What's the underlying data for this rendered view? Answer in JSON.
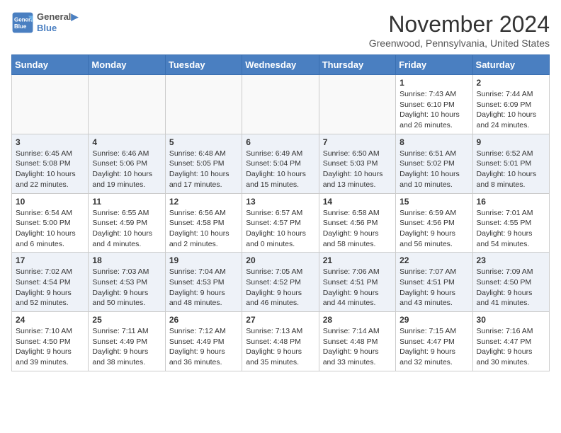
{
  "logo": {
    "line1": "General",
    "line2": "Blue"
  },
  "title": "November 2024",
  "location": "Greenwood, Pennsylvania, United States",
  "days_header": [
    "Sunday",
    "Monday",
    "Tuesday",
    "Wednesday",
    "Thursday",
    "Friday",
    "Saturday"
  ],
  "weeks": [
    [
      {
        "day": "",
        "sunrise": "",
        "sunset": "",
        "daylight": ""
      },
      {
        "day": "",
        "sunrise": "",
        "sunset": "",
        "daylight": ""
      },
      {
        "day": "",
        "sunrise": "",
        "sunset": "",
        "daylight": ""
      },
      {
        "day": "",
        "sunrise": "",
        "sunset": "",
        "daylight": ""
      },
      {
        "day": "",
        "sunrise": "",
        "sunset": "",
        "daylight": ""
      },
      {
        "day": "1",
        "sunrise": "Sunrise: 7:43 AM",
        "sunset": "Sunset: 6:10 PM",
        "daylight": "Daylight: 10 hours and 26 minutes."
      },
      {
        "day": "2",
        "sunrise": "Sunrise: 7:44 AM",
        "sunset": "Sunset: 6:09 PM",
        "daylight": "Daylight: 10 hours and 24 minutes."
      }
    ],
    [
      {
        "day": "3",
        "sunrise": "Sunrise: 6:45 AM",
        "sunset": "Sunset: 5:08 PM",
        "daylight": "Daylight: 10 hours and 22 minutes."
      },
      {
        "day": "4",
        "sunrise": "Sunrise: 6:46 AM",
        "sunset": "Sunset: 5:06 PM",
        "daylight": "Daylight: 10 hours and 19 minutes."
      },
      {
        "day": "5",
        "sunrise": "Sunrise: 6:48 AM",
        "sunset": "Sunset: 5:05 PM",
        "daylight": "Daylight: 10 hours and 17 minutes."
      },
      {
        "day": "6",
        "sunrise": "Sunrise: 6:49 AM",
        "sunset": "Sunset: 5:04 PM",
        "daylight": "Daylight: 10 hours and 15 minutes."
      },
      {
        "day": "7",
        "sunrise": "Sunrise: 6:50 AM",
        "sunset": "Sunset: 5:03 PM",
        "daylight": "Daylight: 10 hours and 13 minutes."
      },
      {
        "day": "8",
        "sunrise": "Sunrise: 6:51 AM",
        "sunset": "Sunset: 5:02 PM",
        "daylight": "Daylight: 10 hours and 10 minutes."
      },
      {
        "day": "9",
        "sunrise": "Sunrise: 6:52 AM",
        "sunset": "Sunset: 5:01 PM",
        "daylight": "Daylight: 10 hours and 8 minutes."
      }
    ],
    [
      {
        "day": "10",
        "sunrise": "Sunrise: 6:54 AM",
        "sunset": "Sunset: 5:00 PM",
        "daylight": "Daylight: 10 hours and 6 minutes."
      },
      {
        "day": "11",
        "sunrise": "Sunrise: 6:55 AM",
        "sunset": "Sunset: 4:59 PM",
        "daylight": "Daylight: 10 hours and 4 minutes."
      },
      {
        "day": "12",
        "sunrise": "Sunrise: 6:56 AM",
        "sunset": "Sunset: 4:58 PM",
        "daylight": "Daylight: 10 hours and 2 minutes."
      },
      {
        "day": "13",
        "sunrise": "Sunrise: 6:57 AM",
        "sunset": "Sunset: 4:57 PM",
        "daylight": "Daylight: 10 hours and 0 minutes."
      },
      {
        "day": "14",
        "sunrise": "Sunrise: 6:58 AM",
        "sunset": "Sunset: 4:56 PM",
        "daylight": "Daylight: 9 hours and 58 minutes."
      },
      {
        "day": "15",
        "sunrise": "Sunrise: 6:59 AM",
        "sunset": "Sunset: 4:56 PM",
        "daylight": "Daylight: 9 hours and 56 minutes."
      },
      {
        "day": "16",
        "sunrise": "Sunrise: 7:01 AM",
        "sunset": "Sunset: 4:55 PM",
        "daylight": "Daylight: 9 hours and 54 minutes."
      }
    ],
    [
      {
        "day": "17",
        "sunrise": "Sunrise: 7:02 AM",
        "sunset": "Sunset: 4:54 PM",
        "daylight": "Daylight: 9 hours and 52 minutes."
      },
      {
        "day": "18",
        "sunrise": "Sunrise: 7:03 AM",
        "sunset": "Sunset: 4:53 PM",
        "daylight": "Daylight: 9 hours and 50 minutes."
      },
      {
        "day": "19",
        "sunrise": "Sunrise: 7:04 AM",
        "sunset": "Sunset: 4:53 PM",
        "daylight": "Daylight: 9 hours and 48 minutes."
      },
      {
        "day": "20",
        "sunrise": "Sunrise: 7:05 AM",
        "sunset": "Sunset: 4:52 PM",
        "daylight": "Daylight: 9 hours and 46 minutes."
      },
      {
        "day": "21",
        "sunrise": "Sunrise: 7:06 AM",
        "sunset": "Sunset: 4:51 PM",
        "daylight": "Daylight: 9 hours and 44 minutes."
      },
      {
        "day": "22",
        "sunrise": "Sunrise: 7:07 AM",
        "sunset": "Sunset: 4:51 PM",
        "daylight": "Daylight: 9 hours and 43 minutes."
      },
      {
        "day": "23",
        "sunrise": "Sunrise: 7:09 AM",
        "sunset": "Sunset: 4:50 PM",
        "daylight": "Daylight: 9 hours and 41 minutes."
      }
    ],
    [
      {
        "day": "24",
        "sunrise": "Sunrise: 7:10 AM",
        "sunset": "Sunset: 4:50 PM",
        "daylight": "Daylight: 9 hours and 39 minutes."
      },
      {
        "day": "25",
        "sunrise": "Sunrise: 7:11 AM",
        "sunset": "Sunset: 4:49 PM",
        "daylight": "Daylight: 9 hours and 38 minutes."
      },
      {
        "day": "26",
        "sunrise": "Sunrise: 7:12 AM",
        "sunset": "Sunset: 4:49 PM",
        "daylight": "Daylight: 9 hours and 36 minutes."
      },
      {
        "day": "27",
        "sunrise": "Sunrise: 7:13 AM",
        "sunset": "Sunset: 4:48 PM",
        "daylight": "Daylight: 9 hours and 35 minutes."
      },
      {
        "day": "28",
        "sunrise": "Sunrise: 7:14 AM",
        "sunset": "Sunset: 4:48 PM",
        "daylight": "Daylight: 9 hours and 33 minutes."
      },
      {
        "day": "29",
        "sunrise": "Sunrise: 7:15 AM",
        "sunset": "Sunset: 4:47 PM",
        "daylight": "Daylight: 9 hours and 32 minutes."
      },
      {
        "day": "30",
        "sunrise": "Sunrise: 7:16 AM",
        "sunset": "Sunset: 4:47 PM",
        "daylight": "Daylight: 9 hours and 30 minutes."
      }
    ]
  ],
  "colors": {
    "header_bg": "#4a7fc1",
    "header_text": "#ffffff",
    "row_alt": "#eef2f8"
  }
}
